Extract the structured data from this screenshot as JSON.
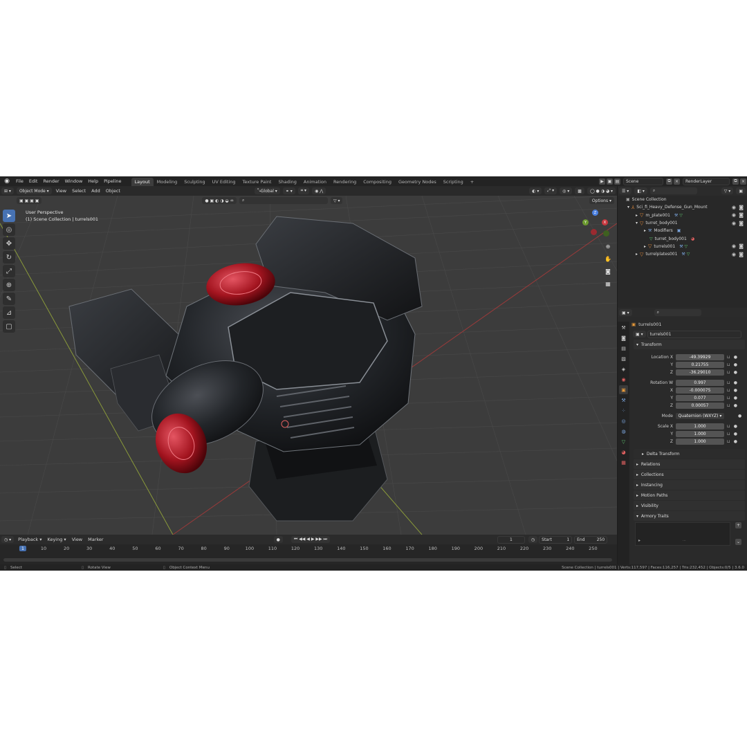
{
  "menu": [
    "File",
    "Edit",
    "Render",
    "Window",
    "Help",
    "Pipeline"
  ],
  "workspaces": [
    "Layout",
    "Modeling",
    "Sculpting",
    "UV Editing",
    "Texture Paint",
    "Shading",
    "Animation",
    "Rendering",
    "Compositing",
    "Geometry Nodes",
    "Scripting"
  ],
  "active_workspace": "Layout",
  "scene_name": "Scene",
  "view_layer": "RenderLayer",
  "viewport_header": {
    "mode": "Object Mode",
    "view": "View",
    "select": "Select",
    "add": "Add",
    "object": "Object",
    "orientation": "Global",
    "options": "Options"
  },
  "viewport_info": {
    "perspective": "User Perspective",
    "collection": "(1) Scene Collection | turrels001"
  },
  "outliner": {
    "root": "Scene Collection",
    "items": [
      {
        "name": "Sci_fi_Heavy_Defense_Gun_Mount",
        "indent": 1
      },
      {
        "name": "m_plate001",
        "indent": 2
      },
      {
        "name": "turret_body001",
        "indent": 2
      },
      {
        "name": "Modifiers",
        "indent": 3
      },
      {
        "name": "turret_body001",
        "indent": 3
      },
      {
        "name": "turrels001",
        "indent": 3
      },
      {
        "name": "turrelplates001",
        "indent": 2
      }
    ]
  },
  "properties": {
    "object_name": "turrels001",
    "object_field": "turrels001",
    "transform_title": "Transform",
    "location": {
      "label": "Location X",
      "x": "-49.39929",
      "y": "0.21755",
      "z": "-36.29010"
    },
    "rotation": {
      "label": "Rotation W",
      "w": "0.997",
      "x": "-0.000075",
      "y": "0.077",
      "z": "0.00057"
    },
    "mode_label": "Mode",
    "mode_value": "Quaternion (WXYZ)",
    "scale": {
      "label": "Scale X",
      "x": "1.000",
      "y": "1.000",
      "z": "1.000"
    },
    "axis_y": "Y",
    "axis_z": "Z",
    "axis_x": "X",
    "delta_transform": "Delta Transform",
    "sections": [
      "Relations",
      "Collections",
      "Instancing",
      "Motion Paths",
      "Visibility",
      "Armory Traits"
    ]
  },
  "timeline": {
    "menus": [
      "Playback",
      "Keying",
      "View",
      "Marker"
    ],
    "current_frame": "1",
    "start_label": "Start",
    "start": "1",
    "end_label": "End",
    "end": "250",
    "ruler": [
      "1",
      "10",
      "20",
      "30",
      "40",
      "50",
      "60",
      "70",
      "80",
      "90",
      "100",
      "110",
      "120",
      "130",
      "140",
      "150",
      "160",
      "170",
      "180",
      "190",
      "200",
      "210",
      "220",
      "230",
      "240",
      "250"
    ]
  },
  "statusbar": {
    "select": "Select",
    "rotate": "Rotate View",
    "context": "Object Context Menu",
    "stats": "Scene Collection | turrels001 | Verts:117,597 | Faces:116,257 | Tris:232,452 | Objects:0/5 | 3.6.0"
  },
  "colors": {
    "accent": "#4772b3",
    "background": "#1d1d1d",
    "viewport": "#3c3c3c",
    "turret_red": "#b0202a"
  }
}
